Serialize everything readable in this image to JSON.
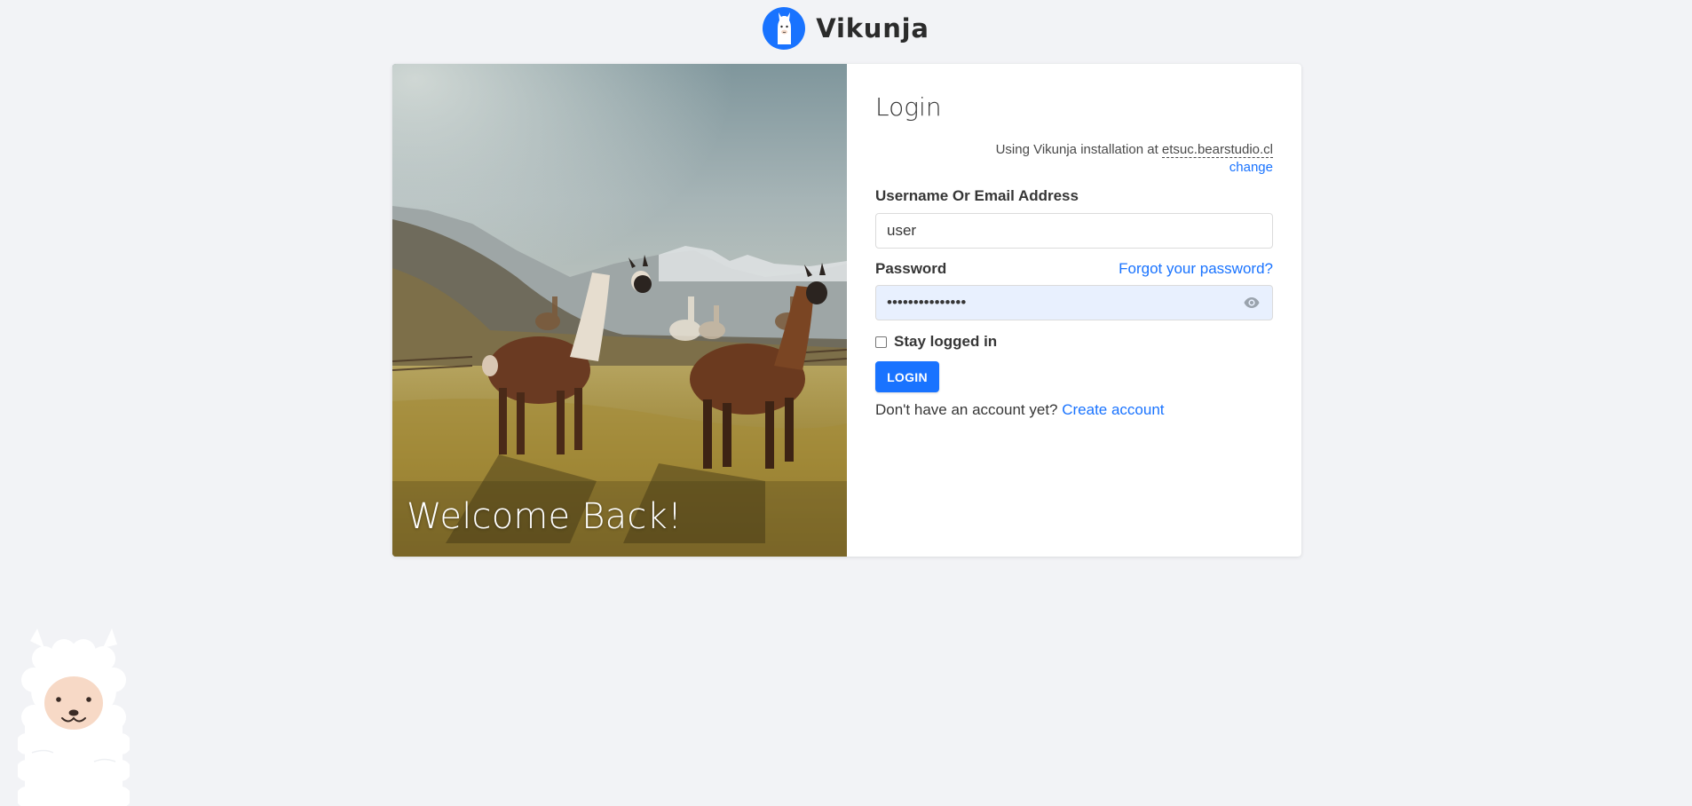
{
  "app": {
    "name": "Vikunja"
  },
  "hero": {
    "title": "Welcome Back!"
  },
  "login": {
    "title": "Login",
    "install_prefix": "Using Vikunja installation at",
    "install_host": "etsuc.bearstudio.cl",
    "change_label": "change",
    "username_label": "Username Or Email Address",
    "username_value": "user",
    "password_label": "Password",
    "forgot_label": "Forgot your password?",
    "password_value": "•••••••••••••••",
    "stay_logged_label": "Stay logged in",
    "stay_logged_checked": false,
    "submit_label": "LOGIN",
    "signup_prefix": "Don't have an account yet?",
    "signup_label": "Create account"
  },
  "icons": {
    "logo": "vikunja-llama-logo-icon",
    "password_toggle": "eye-icon",
    "mascot": "llama-mascot-icon"
  },
  "colors": {
    "primary": "#1973ff",
    "background": "#f2f3f6",
    "autofill": "#e8f0fe",
    "text": "#363636"
  }
}
